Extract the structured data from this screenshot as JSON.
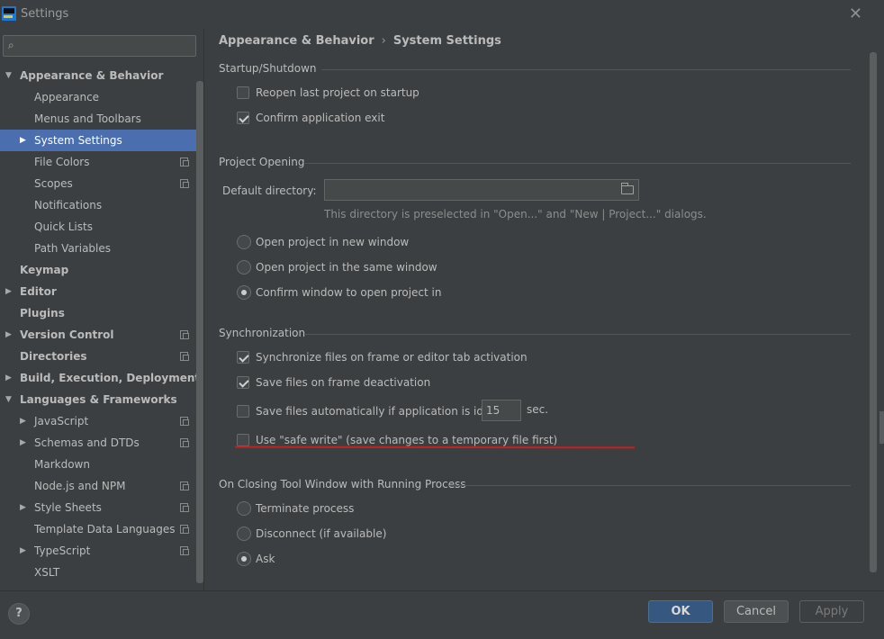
{
  "window": {
    "title": "Settings",
    "logo_label": "WS",
    "close_symbol": "✕"
  },
  "search": {
    "placeholder": "",
    "icon": "search-icon"
  },
  "sidebar": {
    "items": [
      {
        "label": "Appearance & Behavior",
        "level": 0,
        "expander": "expanded",
        "bold": true,
        "copy": false,
        "selected": false
      },
      {
        "label": "Appearance",
        "level": 1,
        "expander": "none",
        "bold": false,
        "copy": false,
        "selected": false
      },
      {
        "label": "Menus and Toolbars",
        "level": 1,
        "expander": "none",
        "bold": false,
        "copy": false,
        "selected": false
      },
      {
        "label": "System Settings",
        "level": 1,
        "expander": "collapsed",
        "bold": false,
        "copy": false,
        "selected": true
      },
      {
        "label": "File Colors",
        "level": 1,
        "expander": "none",
        "bold": false,
        "copy": true,
        "selected": false
      },
      {
        "label": "Scopes",
        "level": 1,
        "expander": "none",
        "bold": false,
        "copy": true,
        "selected": false
      },
      {
        "label": "Notifications",
        "level": 1,
        "expander": "none",
        "bold": false,
        "copy": false,
        "selected": false
      },
      {
        "label": "Quick Lists",
        "level": 1,
        "expander": "none",
        "bold": false,
        "copy": false,
        "selected": false
      },
      {
        "label": "Path Variables",
        "level": 1,
        "expander": "none",
        "bold": false,
        "copy": false,
        "selected": false
      },
      {
        "label": "Keymap",
        "level": 0,
        "expander": "none",
        "bold": true,
        "copy": false,
        "selected": false
      },
      {
        "label": "Editor",
        "level": 0,
        "expander": "collapsed",
        "bold": true,
        "copy": false,
        "selected": false
      },
      {
        "label": "Plugins",
        "level": 0,
        "expander": "none",
        "bold": true,
        "copy": false,
        "selected": false
      },
      {
        "label": "Version Control",
        "level": 0,
        "expander": "collapsed",
        "bold": true,
        "copy": true,
        "selected": false
      },
      {
        "label": "Directories",
        "level": 0,
        "expander": "none",
        "bold": true,
        "copy": true,
        "selected": false
      },
      {
        "label": "Build, Execution, Deployment",
        "level": 0,
        "expander": "collapsed",
        "bold": true,
        "copy": false,
        "selected": false
      },
      {
        "label": "Languages & Frameworks",
        "level": 0,
        "expander": "expanded",
        "bold": true,
        "copy": false,
        "selected": false
      },
      {
        "label": "JavaScript",
        "level": 1,
        "expander": "collapsed",
        "bold": false,
        "copy": true,
        "selected": false
      },
      {
        "label": "Schemas and DTDs",
        "level": 1,
        "expander": "collapsed",
        "bold": false,
        "copy": true,
        "selected": false
      },
      {
        "label": "Markdown",
        "level": 1,
        "expander": "none",
        "bold": false,
        "copy": false,
        "selected": false
      },
      {
        "label": "Node.js and NPM",
        "level": 1,
        "expander": "none",
        "bold": false,
        "copy": true,
        "selected": false
      },
      {
        "label": "Style Sheets",
        "level": 1,
        "expander": "collapsed",
        "bold": false,
        "copy": true,
        "selected": false
      },
      {
        "label": "Template Data Languages",
        "level": 1,
        "expander": "none",
        "bold": false,
        "copy": true,
        "selected": false
      },
      {
        "label": "TypeScript",
        "level": 1,
        "expander": "collapsed",
        "bold": false,
        "copy": true,
        "selected": false
      },
      {
        "label": "XSLT",
        "level": 1,
        "expander": "none",
        "bold": false,
        "copy": false,
        "selected": false
      }
    ]
  },
  "breadcrumb": {
    "parent": "Appearance & Behavior",
    "separator": "›",
    "current": "System Settings"
  },
  "startup": {
    "title": "Startup/Shutdown",
    "reopen_label": "Reopen last project on startup",
    "reopen_checked": false,
    "confirm_exit_label": "Confirm application exit",
    "confirm_exit_checked": true
  },
  "project_opening": {
    "title": "Project Opening",
    "dir_label": "Default directory:",
    "dir_value": "",
    "dir_hint": "This directory is preselected in \"Open...\" and \"New | Project...\" dialogs.",
    "options": [
      {
        "label": "Open project in new window",
        "checked": false
      },
      {
        "label": "Open project in the same window",
        "checked": false
      },
      {
        "label": "Confirm window to open project in",
        "checked": true
      }
    ]
  },
  "sync": {
    "title": "Synchronization",
    "frame_label": "Synchronize files on frame or editor tab activation",
    "frame_checked": true,
    "deactivation_label": "Save files on frame deactivation",
    "deactivation_checked": true,
    "idle_label": "Save files automatically if application is idle for",
    "idle_checked": false,
    "idle_value": "15",
    "idle_unit": "sec.",
    "safe_write_label": "Use \"safe write\" (save changes to a temporary file first)",
    "safe_write_checked": false
  },
  "closing": {
    "title": "On Closing Tool Window with Running Process",
    "options": [
      {
        "label": "Terminate process",
        "checked": false
      },
      {
        "label": "Disconnect (if available)",
        "checked": false
      },
      {
        "label": "Ask",
        "checked": true
      }
    ]
  },
  "footer": {
    "help": "?",
    "ok": "OK",
    "cancel": "Cancel",
    "apply": "Apply"
  },
  "colors": {
    "selection": "#4b6eaf",
    "background": "#3c3f41",
    "annotation_underline": "#c42121",
    "ok_button": "#365880"
  }
}
